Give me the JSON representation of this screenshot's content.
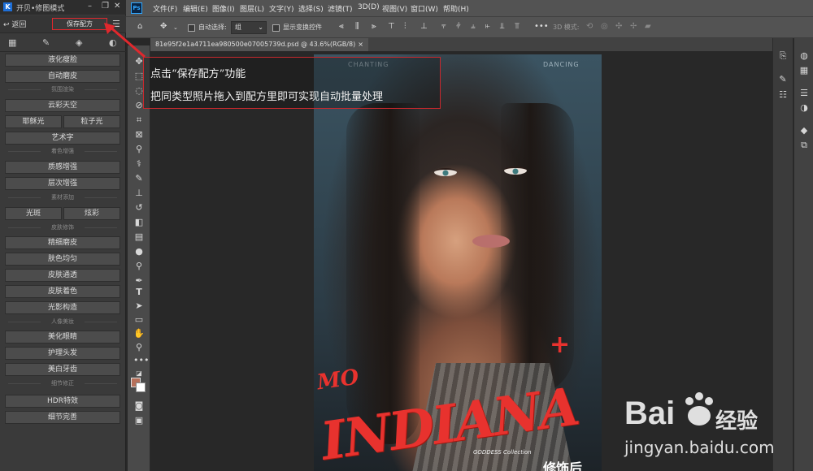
{
  "plugin": {
    "title": "开贝•修图模式",
    "back_label": "返回",
    "save_recipe_label": "保存配方",
    "buttons": {
      "liquify": "液化瘦脸",
      "auto_skin": "自动磨皮",
      "sec_atmosphere": "氛围渲染",
      "sky": "云彩天空",
      "god_rays": "耶稣光",
      "particle_light": "粒子光",
      "art_text": "艺术字",
      "sec_color": "着色增强",
      "texture": "质感增强",
      "layering": "层次增强",
      "sec_material": "素材添加",
      "light_spot": "光斑",
      "dazzle": "炫彩",
      "sec_skin": "皮肤修饰",
      "fine_skin": "精细磨皮",
      "even_tone": "肤色均匀",
      "skin_clear": "皮肤通透",
      "skin_tone": "皮肤着色",
      "light_shape": "光影构造",
      "sec_portrait": "人像美妆",
      "eyes": "美化眼睛",
      "hair": "护理头发",
      "teeth": "美白牙齿",
      "sec_detail": "细节修正",
      "hdr": "HDR特效",
      "detail": "细节完善"
    }
  },
  "menubar": {
    "items": [
      "文件(F)",
      "编辑(E)",
      "图像(I)",
      "图层(L)",
      "文字(Y)",
      "选择(S)",
      "滤镜(T)",
      "3D(D)",
      "视图(V)",
      "窗口(W)",
      "帮助(H)"
    ]
  },
  "options": {
    "auto_select_label": "自动选择:",
    "layer_value": "组",
    "show_transform_label": "显示变换控件",
    "mode_label": "3D 模式:"
  },
  "document": {
    "tab_label": "81e95f2e1a4711ea980500e07005739d.psd @ 43.6%(RGB/8)",
    "close": "×"
  },
  "photo": {
    "header_left": "CHANTING",
    "header_right": "DANCING",
    "brand_prefix": "MO",
    "brand_title": "INDIANA",
    "brand_plus": "+",
    "brand_sub": "GODDESS Collection",
    "after_label": "修饰后"
  },
  "annotation": {
    "line1": "点击“保存配方”功能",
    "line2": "把同类型照片拖入到配方里即可实现自动批量处理"
  },
  "watermark": {
    "brand": "经验",
    "url": "jingyan.baidu.com"
  },
  "colors": {
    "foreground": "#b7705a",
    "background": "#ffffff",
    "accent_red": "#e0282d"
  }
}
